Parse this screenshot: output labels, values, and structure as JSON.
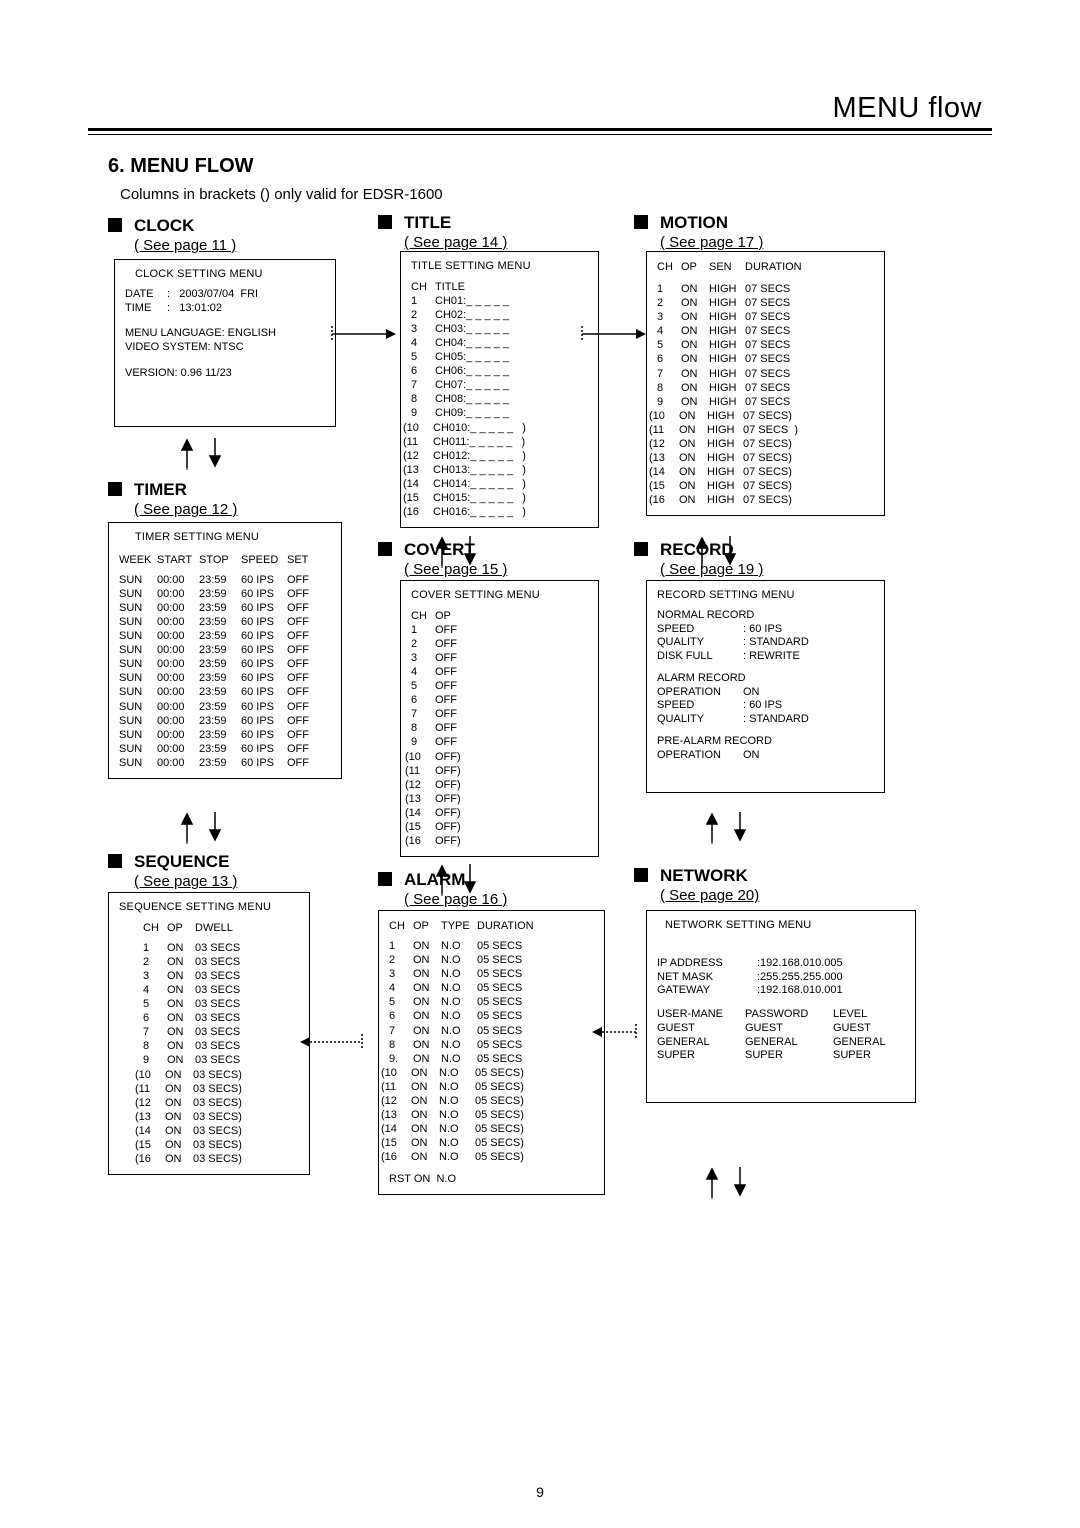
{
  "header": {
    "title": "MENU flow"
  },
  "h6": "6. MENU FLOW",
  "note": "Columns in brackets () only valid for EDSR-1600",
  "pgnum": "9",
  "clock": {
    "title": "CLOCK",
    "sub": "( See page 11  )",
    "menu": "CLOCK SETTING MENU",
    "date_lbl": "DATE",
    "date_val": ":   2003/07/04  FRI",
    "time_lbl": "TIME",
    "time_val": ":   13:01:02",
    "lang": "MENU LANGUAGE: ENGLISH",
    "video": "VIDEO SYSTEM: NTSC",
    "ver": "VERSION: 0.96 11/23"
  },
  "timer": {
    "title": "TIMER",
    "sub": "( See page 12 )",
    "menu": "TIMER  SETTING MENU",
    "hdr": {
      "wk": "WEEK",
      "st": "START",
      "sp": "STOP",
      "spd": "SPEED",
      "set": "SET"
    },
    "rows": [
      {
        "wk": "SUN",
        "st": "00:00",
        "sp": "23:59",
        "spd": "60 IPS",
        "set": "OFF"
      },
      {
        "wk": "SUN",
        "st": "00:00",
        "sp": "23:59",
        "spd": "60 IPS",
        "set": "OFF"
      },
      {
        "wk": "SUN",
        "st": "00:00",
        "sp": "23:59",
        "spd": "60 IPS",
        "set": "OFF"
      },
      {
        "wk": "SUN",
        "st": "00:00",
        "sp": "23:59",
        "spd": "60 IPS",
        "set": "OFF"
      },
      {
        "wk": "SUN",
        "st": "00:00",
        "sp": "23:59",
        "spd": "60 IPS",
        "set": "OFF"
      },
      {
        "wk": "SUN",
        "st": "00:00",
        "sp": "23:59",
        "spd": "60 IPS",
        "set": "OFF"
      },
      {
        "wk": "SUN",
        "st": "00:00",
        "sp": "23:59",
        "spd": "60 IPS",
        "set": "OFF"
      },
      {
        "wk": "SUN",
        "st": "00:00",
        "sp": "23:59",
        "spd": "60 IPS",
        "set": "OFF"
      },
      {
        "wk": "SUN",
        "st": "00:00",
        "sp": "23:59",
        "spd": "60 IPS",
        "set": "OFF"
      },
      {
        "wk": "SUN",
        "st": "00:00",
        "sp": "23:59",
        "spd": "60 IPS",
        "set": "OFF"
      },
      {
        "wk": "SUN",
        "st": "00:00",
        "sp": "23:59",
        "spd": "60 IPS",
        "set": "OFF"
      },
      {
        "wk": "SUN",
        "st": "00:00",
        "sp": "23:59",
        "spd": "60 IPS",
        "set": "OFF"
      },
      {
        "wk": "SUN",
        "st": "00:00",
        "sp": "23:59",
        "spd": "60 IPS",
        "set": "OFF"
      },
      {
        "wk": "SUN",
        "st": "00:00",
        "sp": "23:59",
        "spd": "60 IPS",
        "set": "OFF"
      }
    ]
  },
  "sequence": {
    "title": "SEQUENCE",
    "sub": "( See page 13 )",
    "menu": "SEQUENCE SETTING MENU",
    "hdr": {
      "ch": "CH",
      "op": "OP",
      "dw": "DWELL"
    },
    "rows": [
      {
        "ch": "1",
        "op": "ON",
        "dw": "03 SECS",
        "b": false
      },
      {
        "ch": "2",
        "op": "ON",
        "dw": "03 SECS",
        "b": false
      },
      {
        "ch": "3",
        "op": "ON",
        "dw": "03 SECS",
        "b": false
      },
      {
        "ch": "4",
        "op": "ON",
        "dw": "03 SECS",
        "b": false
      },
      {
        "ch": "5",
        "op": "ON",
        "dw": "03 SECS",
        "b": false
      },
      {
        "ch": "6",
        "op": "ON",
        "dw": "03 SECS",
        "b": false
      },
      {
        "ch": "7",
        "op": "ON",
        "dw": "03 SECS",
        "b": false
      },
      {
        "ch": "8",
        "op": "ON",
        "dw": "03 SECS",
        "b": false
      },
      {
        "ch": "9",
        "op": "ON",
        "dw": "03 SECS",
        "b": false
      },
      {
        "ch": "(10",
        "op": "ON",
        "dw": "03 SECS)",
        "b": true
      },
      {
        "ch": "(11",
        "op": "ON",
        "dw": "03 SECS)",
        "b": true
      },
      {
        "ch": "(12",
        "op": "ON",
        "dw": "03 SECS)",
        "b": true
      },
      {
        "ch": "(13",
        "op": "ON",
        "dw": "03 SECS)",
        "b": true
      },
      {
        "ch": "(14",
        "op": "ON",
        "dw": "03 SECS)",
        "b": true
      },
      {
        "ch": "(15",
        "op": "ON",
        "dw": "03 SECS)",
        "b": true
      },
      {
        "ch": "(16",
        "op": "ON",
        "dw": "03 SECS)",
        "b": true
      }
    ]
  },
  "titleBox": {
    "title": "TITLE",
    "sub": "( See page 14 )",
    "menu": "TITLE SETTING MENU",
    "hdr": {
      "ch": "CH",
      "ti": "TITLE"
    },
    "rows": [
      {
        "ch": "1",
        "ti": "CH01:_ _ _ _ _",
        "b": false
      },
      {
        "ch": "2",
        "ti": "CH02:_ _ _ _ _",
        "b": false
      },
      {
        "ch": "3",
        "ti": "CH03:_ _ _ _ _",
        "b": false
      },
      {
        "ch": "4",
        "ti": "CH04:_ _ _ _ _",
        "b": false
      },
      {
        "ch": "5",
        "ti": "CH05:_ _ _ _ _",
        "b": false
      },
      {
        "ch": "6",
        "ti": "CH06:_ _ _ _ _",
        "b": false
      },
      {
        "ch": "7",
        "ti": "CH07:_ _ _ _ _",
        "b": false
      },
      {
        "ch": "8",
        "ti": "CH08:_ _ _ _ _",
        "b": false
      },
      {
        "ch": "9",
        "ti": "CH09:_ _ _ _ _",
        "b": false
      },
      {
        "ch": "(10",
        "ti": "CH010:_ _ _ _ _   )",
        "b": true
      },
      {
        "ch": "(11",
        "ti": "CH011:_ _ _ _ _   )",
        "b": true
      },
      {
        "ch": "(12",
        "ti": "CH012:_ _ _ _ _   )",
        "b": true
      },
      {
        "ch": "(13",
        "ti": "CH013:_ _ _ _ _   )",
        "b": true
      },
      {
        "ch": "(14",
        "ti": "CH014:_ _ _ _ _   )",
        "b": true
      },
      {
        "ch": "(15",
        "ti": "CH015:_ _ _ _ _   )",
        "b": true
      },
      {
        "ch": "(16",
        "ti": "CH016:_ _ _ _ _   )",
        "b": true
      }
    ]
  },
  "covert": {
    "title": "COVERT",
    "sub": "( See page 15 )",
    "menu": "COVER SETTING MENU",
    "hdr": {
      "ch": "CH",
      "op": "OP"
    },
    "rows": [
      {
        "ch": "1",
        "op": "OFF",
        "b": false
      },
      {
        "ch": "2",
        "op": "OFF",
        "b": false
      },
      {
        "ch": "3",
        "op": "OFF",
        "b": false
      },
      {
        "ch": "4",
        "op": "OFF",
        "b": false
      },
      {
        "ch": "5",
        "op": "OFF",
        "b": false
      },
      {
        "ch": "6",
        "op": "OFF",
        "b": false
      },
      {
        "ch": "7",
        "op": "OFF",
        "b": false
      },
      {
        "ch": "8",
        "op": "OFF",
        "b": false
      },
      {
        "ch": "9",
        "op": "OFF",
        "b": false
      },
      {
        "ch": "(10",
        "op": "OFF)",
        "b": true
      },
      {
        "ch": "(11",
        "op": "OFF)",
        "b": true
      },
      {
        "ch": "(12",
        "op": "OFF)",
        "b": true
      },
      {
        "ch": "(13",
        "op": "OFF)",
        "b": true
      },
      {
        "ch": "(14",
        "op": "OFF)",
        "b": true
      },
      {
        "ch": "(15",
        "op": "OFF)",
        "b": true
      },
      {
        "ch": "(16",
        "op": "OFF)",
        "b": true
      }
    ]
  },
  "alarm": {
    "title": "ALARM",
    "sub": "( See page 16 )",
    "hdr": {
      "ch": "CH",
      "op": "OP",
      "ty": "TYPE",
      "du": "DURATION"
    },
    "rows": [
      {
        "ch": "1",
        "op": "ON",
        "ty": "N.O",
        "du": "05 SECS",
        "b": false
      },
      {
        "ch": "2",
        "op": "ON",
        "ty": "N.O",
        "du": "05 SECS",
        "b": false
      },
      {
        "ch": "3",
        "op": "ON",
        "ty": "N.O",
        "du": "05 SECS",
        "b": false
      },
      {
        "ch": "4",
        "op": "ON",
        "ty": "N.O",
        "du": "05 SECS",
        "b": false
      },
      {
        "ch": "5",
        "op": "ON",
        "ty": "N.O",
        "du": "05 SECS",
        "b": false
      },
      {
        "ch": "6",
        "op": "ON",
        "ty": "N.O",
        "du": "05 SECS",
        "b": false
      },
      {
        "ch": "7",
        "op": "ON",
        "ty": "N.O",
        "du": "05 SECS",
        "b": false
      },
      {
        "ch": "8",
        "op": "ON",
        "ty": "N.O",
        "du": "05 SECS",
        "b": false
      },
      {
        "ch": "9.",
        "op": "ON",
        "ty": "N.O",
        "du": "05 SECS",
        "b": false
      },
      {
        "ch": "(10",
        "op": "ON",
        "ty": "N.O",
        "du": "05 SECS)",
        "b": true
      },
      {
        "ch": "(11",
        "op": "ON",
        "ty": "N.O",
        "du": "05 SECS)",
        "b": true
      },
      {
        "ch": "(12",
        "op": "ON",
        "ty": "N.O",
        "du": "05 SECS)",
        "b": true
      },
      {
        "ch": "(13",
        "op": "ON",
        "ty": "N.O",
        "du": "05 SECS)",
        "b": true
      },
      {
        "ch": "(14",
        "op": "ON",
        "ty": "N.O",
        "du": "05 SECS)",
        "b": true
      },
      {
        "ch": "(15",
        "op": "ON",
        "ty": "N.O",
        "du": "05 SECS)",
        "b": true
      },
      {
        "ch": "(16",
        "op": "ON",
        "ty": "N.O",
        "du": "05 SECS)",
        "b": true
      }
    ],
    "rst": "RST ON  N.O"
  },
  "motion": {
    "title": "MOTION",
    "sub": "( See page 17 )",
    "hdr": {
      "ch": "CH",
      "op": "OP",
      "sen": "SEN",
      "du": "DURATION"
    },
    "rows": [
      {
        "ch": "1",
        "op": "ON",
        "sen": "HIGH",
        "du": "07 SECS",
        "b": false
      },
      {
        "ch": "2",
        "op": "ON",
        "sen": "HIGH",
        "du": "07 SECS",
        "b": false
      },
      {
        "ch": "3",
        "op": "ON",
        "sen": "HIGH",
        "du": "07 SECS",
        "b": false
      },
      {
        "ch": "4",
        "op": "ON",
        "sen": "HIGH",
        "du": "07 SECS",
        "b": false
      },
      {
        "ch": "5",
        "op": "ON",
        "sen": "HIGH",
        "du": "07 SECS",
        "b": false
      },
      {
        "ch": "6",
        "op": "ON",
        "sen": "HIGH",
        "du": "07 SECS",
        "b": false
      },
      {
        "ch": "7",
        "op": "ON",
        "sen": "HIGH",
        "du": "07 SECS",
        "b": false
      },
      {
        "ch": "8",
        "op": "ON",
        "sen": "HIGH",
        "du": "07 SECS",
        "b": false
      },
      {
        "ch": "9",
        "op": "ON",
        "sen": "HIGH",
        "du": "07 SECS",
        "b": false
      },
      {
        "ch": "(10",
        "op": "ON",
        "sen": "HIGH",
        "du": "07 SECS)",
        "b": true
      },
      {
        "ch": "(11",
        "op": "ON",
        "sen": "HIGH",
        "du": "07 SECS  )",
        "b": true
      },
      {
        "ch": "(12",
        "op": "ON",
        "sen": "HIGH",
        "du": "07 SECS)",
        "b": true
      },
      {
        "ch": "(13",
        "op": "ON",
        "sen": "HIGH",
        "du": "07 SECS)",
        "b": true
      },
      {
        "ch": "(14",
        "op": "ON",
        "sen": "HIGH",
        "du": "07 SECS)",
        "b": true
      },
      {
        "ch": "(15",
        "op": "ON",
        "sen": "HIGH",
        "du": "07 SECS)",
        "b": true
      },
      {
        "ch": "(16",
        "op": "ON",
        "sen": "HIGH",
        "du": "07 SECS)",
        "b": true
      }
    ]
  },
  "record": {
    "title": "RECORD",
    "sub": "( See page 19 )",
    "menu": "RECORD SETTING MENU",
    "normal_hdr": "NORMAL RECORD",
    "speed_lbl": "SPEED",
    "speed_val": ": 60 IPS",
    "qual_lbl": "QUALITY",
    "qual_val": ": STANDARD",
    "disk_lbl": "DISK FULL",
    "disk_val": ": REWRITE",
    "alarm_hdr": "ALARM RECORD",
    "op_lbl": "OPERATION",
    "op_val": "ON",
    "aspd_lbl": "SPEED",
    "aspd_val": ": 60 IPS",
    "aqual_lbl": "QUALITY",
    "aqual_val": ": STANDARD",
    "pre_hdr": "PRE-ALARM RECORD",
    "pop_lbl": "OPERATION",
    "pop_val": "ON"
  },
  "network": {
    "title": "NETWORK",
    "sub": "( See page 20)",
    "menu": "NETWORK  SETTING MENU",
    "ip_lbl": "IP ADDRESS",
    "ip_val": ":192.168.010.005",
    "nm_lbl": "NET MASK",
    "nm_val": ":255.255.255.000",
    "gw_lbl": "GATEWAY",
    "gw_val": ":192.168.010.001",
    "u_hdr": {
      "a": "USER-MANE",
      "b": "PASSWORD",
      "c": "LEVEL"
    },
    "users": [
      {
        "a": "GUEST",
        "b": "GUEST",
        "c": "GUEST"
      },
      {
        "a": "GENERAL",
        "b": "GENERAL",
        "c": "GENERAL"
      },
      {
        "a": "SUPER",
        "b": "SUPER",
        "c": "SUPER"
      }
    ]
  }
}
